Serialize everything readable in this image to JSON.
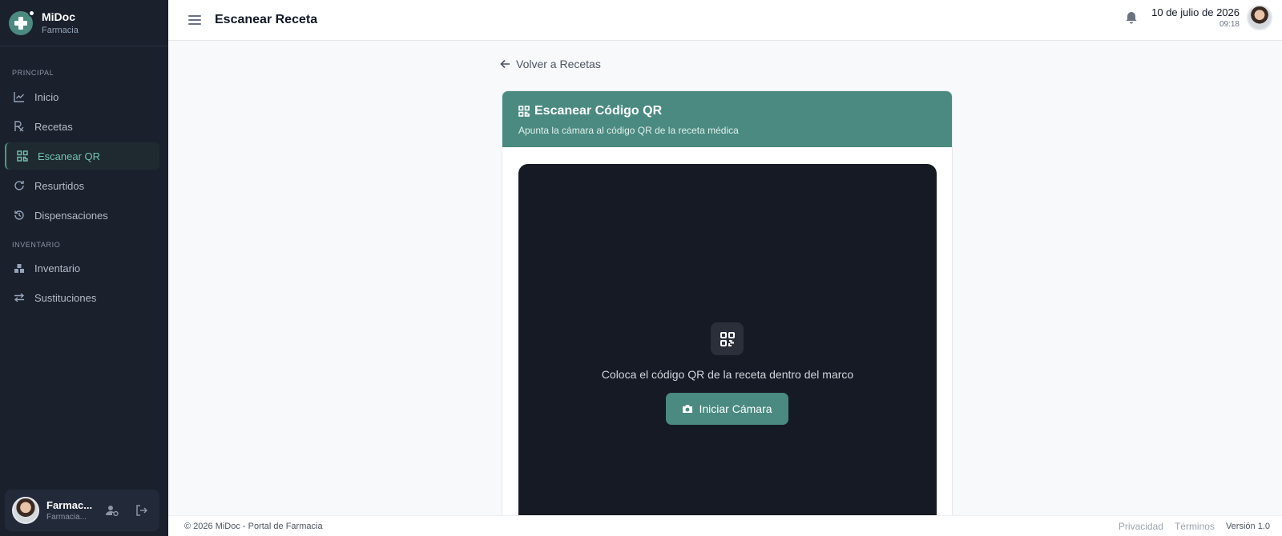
{
  "app": {
    "name": "MiDoc",
    "subtitle": "Farmacia"
  },
  "sidebar": {
    "sections": [
      {
        "label": "PRINCIPAL"
      },
      {
        "label": "INVENTARIO"
      }
    ],
    "items": [
      {
        "label": "Inicio",
        "icon": "chart-line-icon"
      },
      {
        "label": "Recetas",
        "icon": "prescription-icon"
      },
      {
        "label": "Escanear QR",
        "icon": "qr-icon",
        "active": true
      },
      {
        "label": "Resurtidos",
        "icon": "refresh-icon"
      },
      {
        "label": "Dispensaciones",
        "icon": "history-icon"
      },
      {
        "label": "Inventario",
        "icon": "boxes-icon"
      },
      {
        "label": "Sustituciones",
        "icon": "swap-icon"
      }
    ],
    "user": {
      "name": "Farmac...",
      "role": "Farmacia..."
    }
  },
  "header": {
    "title": "Escanear Receta",
    "date": "10 de julio de 2026",
    "time": "09:18"
  },
  "main": {
    "back_label": "Volver a Recetas",
    "card": {
      "title": "Escanear Código QR",
      "subtitle": "Apunta la cámara al código QR de la receta médica",
      "instruction": "Coloca el código QR de la receta dentro del marco",
      "button_label": "Iniciar Cámara"
    }
  },
  "footer": {
    "copyright": "© 2026 MiDoc - Portal de Farmacia",
    "links": [
      "Privacidad",
      "Términos"
    ],
    "version": "Versión 1.0"
  },
  "colors": {
    "accent": "#4a8a80",
    "sidebar_bg": "#1a202c",
    "camera_bg": "#161a24"
  }
}
